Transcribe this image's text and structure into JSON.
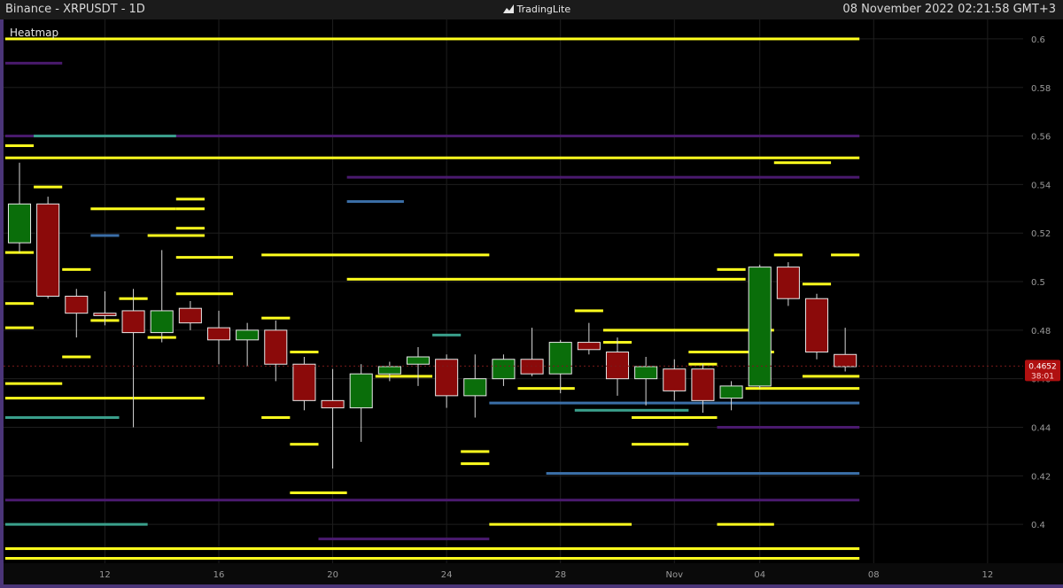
{
  "header": {
    "symbol_label": "Binance - XRPUSDT - 1D",
    "brand": "TradingLite",
    "timestamp": "08 November 2022 02:21:58 GMT+3"
  },
  "panel_label": "Heatmap",
  "colors": {
    "up": "#0a6e0a",
    "down": "#8b0a0a",
    "heat_hot": "#ffff1e",
    "heat_warm": "#3aa08c",
    "heat_cool": "#3b6fa8",
    "heat_cold": "#4a1a6e",
    "grid": "#1e1e1e",
    "bg": "#000000"
  },
  "chart_data": {
    "type": "candlestick",
    "xlim": [
      "2022-10-09",
      "2022-11-13"
    ],
    "ylim": [
      0.384,
      0.608
    ],
    "y_ticks": [
      "0.4",
      "0.42",
      "0.44",
      "0.46",
      "0.48",
      "0.5",
      "0.52",
      "0.54",
      "0.56",
      "0.58",
      "0.6"
    ],
    "x_ticks": [
      {
        "date": "2022-10-12",
        "label": "12"
      },
      {
        "date": "2022-10-16",
        "label": "16"
      },
      {
        "date": "2022-10-20",
        "label": "20"
      },
      {
        "date": "2022-10-24",
        "label": "24"
      },
      {
        "date": "2022-10-28",
        "label": "28"
      },
      {
        "date": "2022-11-01",
        "label": "Nov"
      },
      {
        "date": "2022-11-04",
        "label": "04"
      },
      {
        "date": "2022-11-08",
        "label": "08"
      },
      {
        "date": "2022-11-12",
        "label": "12"
      }
    ],
    "candles": [
      {
        "date": "2022-10-09",
        "open": 0.516,
        "high": 0.549,
        "low": 0.512,
        "close": 0.532
      },
      {
        "date": "2022-10-10",
        "open": 0.532,
        "high": 0.535,
        "low": 0.493,
        "close": 0.494
      },
      {
        "date": "2022-10-11",
        "open": 0.494,
        "high": 0.497,
        "low": 0.477,
        "close": 0.487
      },
      {
        "date": "2022-10-12",
        "open": 0.487,
        "high": 0.496,
        "low": 0.482,
        "close": 0.486
      },
      {
        "date": "2022-10-13",
        "open": 0.488,
        "high": 0.497,
        "low": 0.44,
        "close": 0.479
      },
      {
        "date": "2022-10-14",
        "open": 0.479,
        "high": 0.513,
        "low": 0.475,
        "close": 0.488
      },
      {
        "date": "2022-10-15",
        "open": 0.489,
        "high": 0.492,
        "low": 0.48,
        "close": 0.483
      },
      {
        "date": "2022-10-16",
        "open": 0.481,
        "high": 0.488,
        "low": 0.466,
        "close": 0.476
      },
      {
        "date": "2022-10-17",
        "open": 0.476,
        "high": 0.483,
        "low": 0.465,
        "close": 0.48
      },
      {
        "date": "2022-10-18",
        "open": 0.48,
        "high": 0.484,
        "low": 0.459,
        "close": 0.466
      },
      {
        "date": "2022-10-19",
        "open": 0.466,
        "high": 0.469,
        "low": 0.447,
        "close": 0.451
      },
      {
        "date": "2022-10-20",
        "open": 0.451,
        "high": 0.464,
        "low": 0.423,
        "close": 0.448
      },
      {
        "date": "2022-10-21",
        "open": 0.448,
        "high": 0.466,
        "low": 0.434,
        "close": 0.462
      },
      {
        "date": "2022-10-22",
        "open": 0.462,
        "high": 0.467,
        "low": 0.459,
        "close": 0.465
      },
      {
        "date": "2022-10-23",
        "open": 0.466,
        "high": 0.473,
        "low": 0.457,
        "close": 0.469
      },
      {
        "date": "2022-10-24",
        "open": 0.468,
        "high": 0.47,
        "low": 0.448,
        "close": 0.453
      },
      {
        "date": "2022-10-25",
        "open": 0.453,
        "high": 0.47,
        "low": 0.444,
        "close": 0.46
      },
      {
        "date": "2022-10-26",
        "open": 0.46,
        "high": 0.47,
        "low": 0.457,
        "close": 0.468
      },
      {
        "date": "2022-10-27",
        "open": 0.468,
        "high": 0.481,
        "low": 0.461,
        "close": 0.462
      },
      {
        "date": "2022-10-28",
        "open": 0.462,
        "high": 0.476,
        "low": 0.454,
        "close": 0.475
      },
      {
        "date": "2022-10-29",
        "open": 0.475,
        "high": 0.483,
        "low": 0.47,
        "close": 0.472
      },
      {
        "date": "2022-10-30",
        "open": 0.471,
        "high": 0.477,
        "low": 0.453,
        "close": 0.46
      },
      {
        "date": "2022-10-31",
        "open": 0.46,
        "high": 0.469,
        "low": 0.449,
        "close": 0.465
      },
      {
        "date": "2022-11-01",
        "open": 0.464,
        "high": 0.468,
        "low": 0.451,
        "close": 0.455
      },
      {
        "date": "2022-11-02",
        "open": 0.464,
        "high": 0.466,
        "low": 0.446,
        "close": 0.451
      },
      {
        "date": "2022-11-03",
        "open": 0.452,
        "high": 0.459,
        "low": 0.447,
        "close": 0.457
      },
      {
        "date": "2022-11-04",
        "open": 0.457,
        "high": 0.507,
        "low": 0.456,
        "close": 0.506
      },
      {
        "date": "2022-11-05",
        "open": 0.506,
        "high": 0.508,
        "low": 0.49,
        "close": 0.493
      },
      {
        "date": "2022-11-06",
        "open": 0.493,
        "high": 0.495,
        "low": 0.468,
        "close": 0.471
      },
      {
        "date": "2022-11-07",
        "open": 0.47,
        "high": 0.481,
        "low": 0.463,
        "close": 0.465
      }
    ],
    "last_price": "0.4652",
    "countdown": "38:01",
    "heatmap_levels": [
      {
        "price": 0.6,
        "from": "2022-10-09",
        "to": "2022-11-07",
        "level": "hot"
      },
      {
        "price": 0.59,
        "from": "2022-10-09",
        "to": "2022-10-10",
        "level": "cold"
      },
      {
        "price": 0.56,
        "from": "2022-10-09",
        "to": "2022-11-07",
        "level": "cold"
      },
      {
        "price": 0.56,
        "from": "2022-10-10",
        "to": "2022-10-14",
        "level": "warm"
      },
      {
        "price": 0.556,
        "from": "2022-10-09",
        "to": "2022-10-09",
        "level": "hot"
      },
      {
        "price": 0.551,
        "from": "2022-10-09",
        "to": "2022-11-07",
        "level": "hot"
      },
      {
        "price": 0.549,
        "from": "2022-11-05",
        "to": "2022-11-06",
        "level": "hot"
      },
      {
        "price": 0.543,
        "from": "2022-10-21",
        "to": "2022-11-07",
        "level": "cold"
      },
      {
        "price": 0.539,
        "from": "2022-10-10",
        "to": "2022-10-10",
        "level": "hot"
      },
      {
        "price": 0.534,
        "from": "2022-10-15",
        "to": "2022-10-15",
        "level": "hot"
      },
      {
        "price": 0.533,
        "from": "2022-10-21",
        "to": "2022-10-22",
        "level": "cool"
      },
      {
        "price": 0.53,
        "from": "2022-10-12",
        "to": "2022-10-14",
        "level": "hot"
      },
      {
        "price": 0.53,
        "from": "2022-10-15",
        "to": "2022-10-15",
        "level": "hot"
      },
      {
        "price": 0.522,
        "from": "2022-10-15",
        "to": "2022-10-15",
        "level": "hot"
      },
      {
        "price": 0.519,
        "from": "2022-10-14",
        "to": "2022-10-15",
        "level": "hot"
      },
      {
        "price": 0.519,
        "from": "2022-10-12",
        "to": "2022-10-12",
        "level": "cool"
      },
      {
        "price": 0.512,
        "from": "2022-10-09",
        "to": "2022-10-09",
        "level": "hot"
      },
      {
        "price": 0.511,
        "from": "2022-10-18",
        "to": "2022-10-25",
        "level": "hot"
      },
      {
        "price": 0.511,
        "from": "2022-11-07",
        "to": "2022-11-07",
        "level": "hot"
      },
      {
        "price": 0.511,
        "from": "2022-11-05",
        "to": "2022-11-05",
        "level": "hot"
      },
      {
        "price": 0.51,
        "from": "2022-10-15",
        "to": "2022-10-16",
        "level": "hot"
      },
      {
        "price": 0.505,
        "from": "2022-10-11",
        "to": "2022-10-11",
        "level": "hot"
      },
      {
        "price": 0.505,
        "from": "2022-11-03",
        "to": "2022-11-03",
        "level": "hot"
      },
      {
        "price": 0.501,
        "from": "2022-10-21",
        "to": "2022-11-03",
        "level": "hot"
      },
      {
        "price": 0.499,
        "from": "2022-11-06",
        "to": "2022-11-06",
        "level": "hot"
      },
      {
        "price": 0.495,
        "from": "2022-10-15",
        "to": "2022-10-16",
        "level": "hot"
      },
      {
        "price": 0.493,
        "from": "2022-10-13",
        "to": "2022-10-13",
        "level": "hot"
      },
      {
        "price": 0.491,
        "from": "2022-10-09",
        "to": "2022-10-09",
        "level": "hot"
      },
      {
        "price": 0.488,
        "from": "2022-10-29",
        "to": "2022-10-29",
        "level": "hot"
      },
      {
        "price": 0.485,
        "from": "2022-10-18",
        "to": "2022-10-18",
        "level": "hot"
      },
      {
        "price": 0.484,
        "from": "2022-10-12",
        "to": "2022-10-12",
        "level": "hot"
      },
      {
        "price": 0.481,
        "from": "2022-10-09",
        "to": "2022-10-09",
        "level": "hot"
      },
      {
        "price": 0.48,
        "from": "2022-10-30",
        "to": "2022-11-04",
        "level": "hot"
      },
      {
        "price": 0.478,
        "from": "2022-10-24",
        "to": "2022-10-24",
        "level": "warm"
      },
      {
        "price": 0.477,
        "from": "2022-10-14",
        "to": "2022-10-14",
        "level": "hot"
      },
      {
        "price": 0.475,
        "from": "2022-10-30",
        "to": "2022-10-30",
        "level": "hot"
      },
      {
        "price": 0.471,
        "from": "2022-10-19",
        "to": "2022-10-19",
        "level": "hot"
      },
      {
        "price": 0.471,
        "from": "2022-11-02",
        "to": "2022-11-04",
        "level": "hot"
      },
      {
        "price": 0.469,
        "from": "2022-10-11",
        "to": "2022-10-11",
        "level": "hot"
      },
      {
        "price": 0.466,
        "from": "2022-11-02",
        "to": "2022-11-02",
        "level": "hot"
      },
      {
        "price": 0.461,
        "from": "2022-10-22",
        "to": "2022-10-23",
        "level": "hot"
      },
      {
        "price": 0.461,
        "from": "2022-11-06",
        "to": "2022-11-07",
        "level": "hot"
      },
      {
        "price": 0.458,
        "from": "2022-10-09",
        "to": "2022-10-10",
        "level": "hot"
      },
      {
        "price": 0.456,
        "from": "2022-10-27",
        "to": "2022-10-28",
        "level": "hot"
      },
      {
        "price": 0.456,
        "from": "2022-11-04",
        "to": "2022-11-07",
        "level": "hot"
      },
      {
        "price": 0.452,
        "from": "2022-10-09",
        "to": "2022-10-15",
        "level": "hot"
      },
      {
        "price": 0.45,
        "from": "2022-10-26",
        "to": "2022-11-07",
        "level": "cool"
      },
      {
        "price": 0.447,
        "from": "2022-10-29",
        "to": "2022-11-01",
        "level": "warm"
      },
      {
        "price": 0.444,
        "from": "2022-10-09",
        "to": "2022-10-12",
        "level": "warm"
      },
      {
        "price": 0.444,
        "from": "2022-10-18",
        "to": "2022-10-18",
        "level": "hot"
      },
      {
        "price": 0.444,
        "from": "2022-10-31",
        "to": "2022-11-02",
        "level": "hot"
      },
      {
        "price": 0.44,
        "from": "2022-11-03",
        "to": "2022-11-07",
        "level": "cold"
      },
      {
        "price": 0.433,
        "from": "2022-10-31",
        "to": "2022-11-01",
        "level": "hot"
      },
      {
        "price": 0.433,
        "from": "2022-10-19",
        "to": "2022-10-19",
        "level": "hot"
      },
      {
        "price": 0.43,
        "from": "2022-10-25",
        "to": "2022-10-25",
        "level": "hot"
      },
      {
        "price": 0.425,
        "from": "2022-10-25",
        "to": "2022-10-25",
        "level": "hot"
      },
      {
        "price": 0.421,
        "from": "2022-10-28",
        "to": "2022-11-07",
        "level": "cool"
      },
      {
        "price": 0.413,
        "from": "2022-10-19",
        "to": "2022-10-20",
        "level": "hot"
      },
      {
        "price": 0.41,
        "from": "2022-10-09",
        "to": "2022-11-07",
        "level": "cold"
      },
      {
        "price": 0.4,
        "from": "2022-10-09",
        "to": "2022-10-13",
        "level": "warm"
      },
      {
        "price": 0.4,
        "from": "2022-10-26",
        "to": "2022-10-30",
        "level": "hot"
      },
      {
        "price": 0.4,
        "from": "2022-11-03",
        "to": "2022-11-04",
        "level": "hot"
      },
      {
        "price": 0.394,
        "from": "2022-10-20",
        "to": "2022-10-25",
        "level": "cold"
      },
      {
        "price": 0.39,
        "from": "2022-10-09",
        "to": "2022-11-07",
        "level": "hot"
      },
      {
        "price": 0.386,
        "from": "2022-10-09",
        "to": "2022-11-07",
        "level": "hot"
      }
    ]
  }
}
